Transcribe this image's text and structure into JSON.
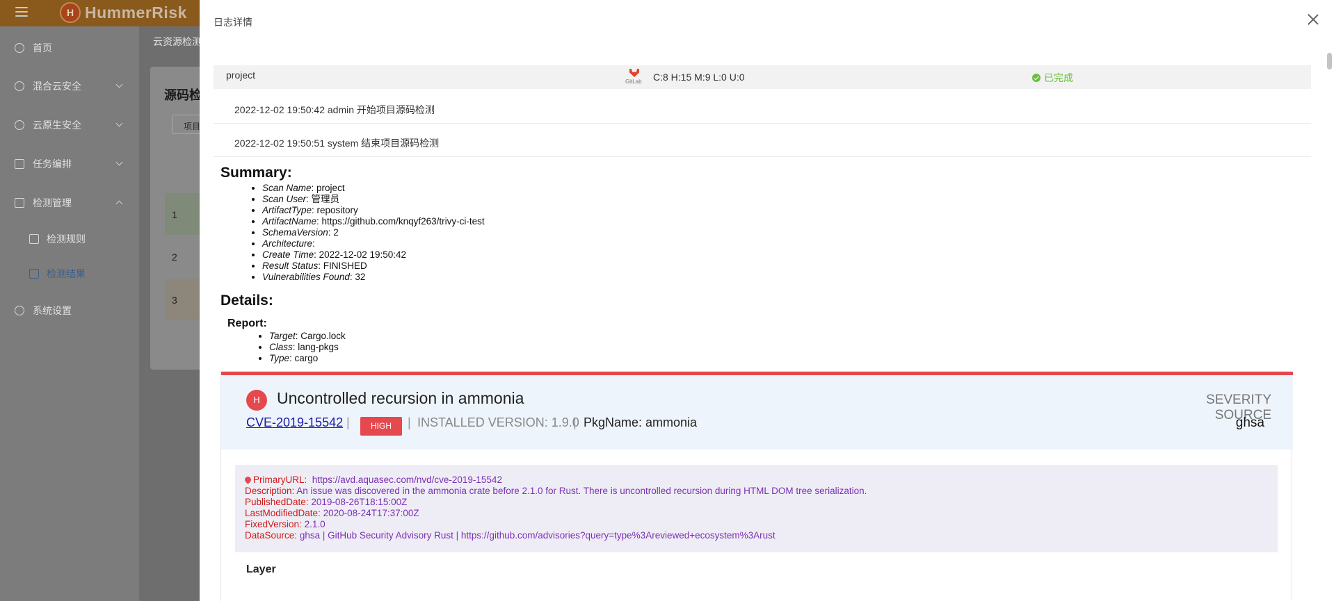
{
  "app": {
    "brand": "HummerRisk",
    "nav": [
      {
        "label": "首页"
      },
      {
        "label": "混合云安全"
      },
      {
        "label": "云原生安全"
      },
      {
        "label": "任务编排"
      },
      {
        "label": "检测管理"
      },
      {
        "label": "检测规则"
      },
      {
        "label": "检测结果"
      },
      {
        "label": "系统设置"
      }
    ],
    "breadcrumb": "云资源检测",
    "card_title": "源码检",
    "card_button": "项目",
    "rows": [
      "1",
      "2",
      "3"
    ]
  },
  "drawer": {
    "title": "日志详情",
    "result_row": {
      "name": "project",
      "platform_icon": "gitlab-icon",
      "platform_label": "GitLab",
      "counts": "C:8 H:15 M:9 L:0 U:0",
      "status": "已完成",
      "status_color": "#67c23a"
    },
    "logs": [
      "2022-12-02 19:50:42 admin 开始项目源码检测",
      "2022-12-02 19:50:51 system 结束项目源码检测"
    ],
    "summary": {
      "heading": "Summary:",
      "items": [
        {
          "key": "Scan Name",
          "value": ": project"
        },
        {
          "key": "Scan User",
          "value": ": 管理员"
        },
        {
          "key": "ArtifactType",
          "value": ": repository"
        },
        {
          "key": "ArtifactName",
          "value": ": https://github.com/knqyf263/trivy-ci-test"
        },
        {
          "key": "SchemaVersion",
          "value": ": 2"
        },
        {
          "key": "Architecture",
          "value": ":"
        },
        {
          "key": "Create Time",
          "value": ": 2022-12-02 19:50:42"
        },
        {
          "key": "Result Status",
          "value": ": FINISHED"
        },
        {
          "key": "Vulnerabilities Found",
          "value": ": 32"
        }
      ]
    },
    "details": {
      "heading": "Details:",
      "report_heading": "Report:",
      "items": [
        {
          "key": "Target",
          "value": ": Cargo.lock"
        },
        {
          "key": "Class",
          "value": ": lang-pkgs"
        },
        {
          "key": "Type",
          "value": ": cargo"
        }
      ]
    },
    "vuln": {
      "severity_letter": "H",
      "title": "Uncontrolled recursion in ammonia",
      "cve": "CVE-2019-15542",
      "severity": "HIGH",
      "severity_color": "#e5484d",
      "separator": "|",
      "installed_version": "INSTALLED VERSION: 1.9.0",
      "pkg_name": "PkgName: ammonia",
      "severity_source_label": "SEVERITY SOURCE",
      "severity_source": "ghsa",
      "info": [
        {
          "label": "PrimaryURL:",
          "value": "https://avd.aquasec.com/nvd/cve-2019-15542"
        },
        {
          "label": "Description:",
          "value": "An issue was discovered in the ammonia crate before 2.1.0 for Rust. There is uncontrolled recursion during HTML DOM tree serialization."
        },
        {
          "label": "PublishedDate:",
          "value": "2019-08-26T18:15:00Z"
        },
        {
          "label": "LastModifiedDate:",
          "value": "2020-08-24T17:37:00Z"
        },
        {
          "label": "FixedVersion:",
          "value": "2.1.0"
        },
        {
          "label": "DataSource:",
          "value": "ghsa | GitHub Security Advisory Rust | https://github.com/advisories?query=type%3Areviewed+ecosystem%3Arust"
        }
      ],
      "layer_heading": "Layer"
    }
  }
}
